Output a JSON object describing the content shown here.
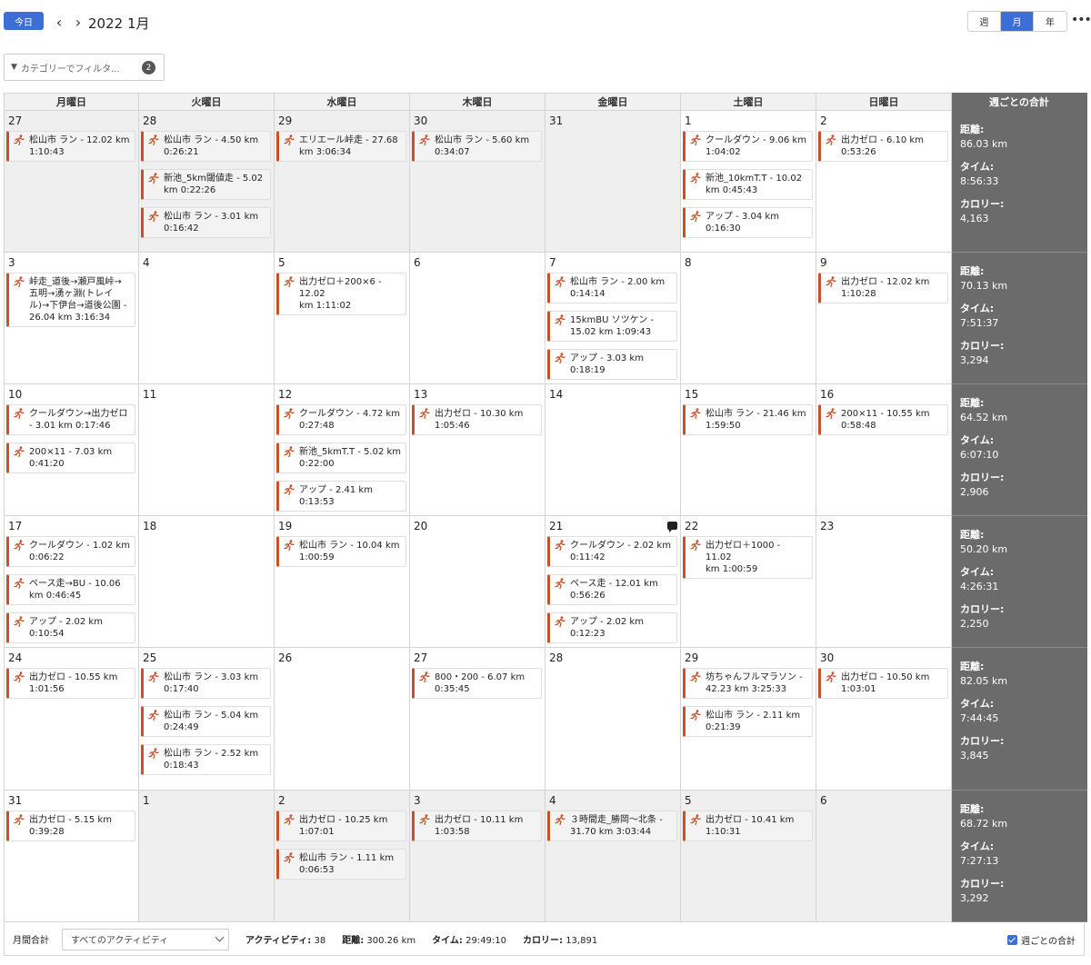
{
  "header": {
    "today_label": "今日",
    "prev_icon": "chevron-left-icon",
    "next_icon": "chevron-right-icon",
    "month_title": "2022 1月",
    "views": [
      {
        "label": "週",
        "active": false
      },
      {
        "label": "月",
        "active": true
      },
      {
        "label": "年",
        "active": false
      }
    ],
    "more_icon": "more-horizontal-icon",
    "accent_color": "#3b6fd6"
  },
  "filter": {
    "placeholder": "カテゴリーでフィルタ...",
    "count": "2"
  },
  "weekdays": [
    "月曜日",
    "火曜日",
    "水曜日",
    "木曜日",
    "金曜日",
    "土曜日",
    "日曜日"
  ],
  "totals_header": "週ごとの合計",
  "totals_labels": {
    "distance": "距離:",
    "time": "タイム:",
    "calories": "カロリー:"
  },
  "activity_color": "#c8512a",
  "activity_icon": "running-person-icon",
  "weeks": [
    {
      "days": [
        {
          "num": "27",
          "other": true,
          "acts": [
            [
              "松山市 ラン - 12.02 km",
              "1:10:43"
            ]
          ]
        },
        {
          "num": "28",
          "other": true,
          "acts": [
            [
              "松山市 ラン - 4.50 km",
              "0:26:21"
            ],
            [
              "新池_5km閾値走 - 5.02",
              "km 0:22:26"
            ],
            [
              "松山市 ラン - 3.01 km",
              "0:16:42"
            ]
          ]
        },
        {
          "num": "29",
          "other": true,
          "acts": [
            [
              "エリエール峠走 - 27.68",
              "km 3:06:34"
            ]
          ]
        },
        {
          "num": "30",
          "other": true,
          "acts": [
            [
              "松山市 ラン - 5.60 km",
              "0:34:07"
            ]
          ]
        },
        {
          "num": "31",
          "other": true,
          "acts": []
        },
        {
          "num": "1",
          "other": false,
          "acts": [
            [
              "クールダウン - 9.06 km",
              "1:04:02"
            ],
            [
              "新池_10kmT.T - 10.02",
              "km 0:45:43"
            ],
            [
              "アップ - 3.04 km 0:16:30"
            ]
          ]
        },
        {
          "num": "2",
          "other": false,
          "acts": [
            [
              "出力ゼロ - 6.10 km",
              "0:53:26"
            ]
          ]
        }
      ],
      "totals": {
        "distance": "86.03 km",
        "time": "8:56:33",
        "calories": "4,163"
      }
    },
    {
      "days": [
        {
          "num": "3",
          "other": false,
          "acts": [
            [
              "峠走_道後→瀬戸風峠→",
              "五明→湧ヶ淵(トレイ",
              "ル)→下伊台→道後公園 -",
              "26.04 km 3:16:34"
            ]
          ]
        },
        {
          "num": "4",
          "other": false,
          "acts": []
        },
        {
          "num": "5",
          "other": false,
          "acts": [
            [
              "出力ゼロ＋200×6 - 12.02",
              "km 1:11:02"
            ]
          ]
        },
        {
          "num": "6",
          "other": false,
          "acts": []
        },
        {
          "num": "7",
          "other": false,
          "acts": [
            [
              "松山市 ラン - 2.00 km",
              "0:14:14"
            ],
            [
              "15kmBU ソツケン -",
              "15.02 km 1:09:43"
            ],
            [
              "アップ - 3.03 km 0:18:19"
            ]
          ]
        },
        {
          "num": "8",
          "other": false,
          "acts": []
        },
        {
          "num": "9",
          "other": false,
          "acts": [
            [
              "出力ゼロ - 12.02 km",
              "1:10:28"
            ]
          ]
        }
      ],
      "totals": {
        "distance": "70.13 km",
        "time": "7:51:37",
        "calories": "3,294"
      }
    },
    {
      "days": [
        {
          "num": "10",
          "other": false,
          "acts": [
            [
              "クールダウン→出力ゼロ",
              "- 3.01 km 0:17:46"
            ],
            [
              "200×11 - 7.03 km",
              "0:41:20"
            ]
          ]
        },
        {
          "num": "11",
          "other": false,
          "acts": []
        },
        {
          "num": "12",
          "other": false,
          "acts": [
            [
              "クールダウン - 4.72 km",
              "0:27:48"
            ],
            [
              "新池_5kmT.T - 5.02 km",
              "0:22:00"
            ],
            [
              "アップ - 2.41 km 0:13:53"
            ]
          ]
        },
        {
          "num": "13",
          "other": false,
          "acts": [
            [
              "出力ゼロ - 10.30 km",
              "1:05:46"
            ]
          ]
        },
        {
          "num": "14",
          "other": false,
          "acts": []
        },
        {
          "num": "15",
          "other": false,
          "acts": [
            [
              "松山市 ラン - 21.46 km",
              "1:59:50"
            ]
          ]
        },
        {
          "num": "16",
          "other": false,
          "acts": [
            [
              "200×11 - 10.55 km",
              "0:58:48"
            ]
          ]
        }
      ],
      "totals": {
        "distance": "64.52 km",
        "time": "6:07:10",
        "calories": "2,906"
      }
    },
    {
      "days": [
        {
          "num": "17",
          "other": false,
          "acts": [
            [
              "クールダウン - 1.02 km",
              "0:06:22"
            ],
            [
              "ペース走→BU - 10.06",
              "km 0:46:45"
            ],
            [
              "アップ - 2.02 km 0:10:54"
            ]
          ]
        },
        {
          "num": "18",
          "other": false,
          "acts": []
        },
        {
          "num": "19",
          "other": false,
          "acts": [
            [
              "松山市 ラン - 10.04 km",
              "1:00:59"
            ]
          ]
        },
        {
          "num": "20",
          "other": false,
          "acts": []
        },
        {
          "num": "21",
          "other": false,
          "comment": true,
          "acts": [
            [
              "クールダウン - 2.02 km",
              "0:11:42"
            ],
            [
              "ペース走 - 12.01 km",
              "0:56:26"
            ],
            [
              "アップ - 2.02 km 0:12:23"
            ]
          ]
        },
        {
          "num": "22",
          "other": false,
          "acts": [
            [
              "出力ゼロ＋1000 - 11.02",
              "km 1:00:59"
            ]
          ]
        },
        {
          "num": "23",
          "other": false,
          "acts": []
        }
      ],
      "totals": {
        "distance": "50.20 km",
        "time": "4:26:31",
        "calories": "2,250"
      }
    },
    {
      "days": [
        {
          "num": "24",
          "other": false,
          "acts": [
            [
              "出力ゼロ - 10.55 km",
              "1:01:56"
            ]
          ]
        },
        {
          "num": "25",
          "other": false,
          "acts": [
            [
              "松山市 ラン - 3.03 km",
              "0:17:40"
            ],
            [
              "松山市 ラン - 5.04 km",
              "0:24:49"
            ],
            [
              "松山市 ラン - 2.52 km",
              "0:18:43"
            ]
          ]
        },
        {
          "num": "26",
          "other": false,
          "acts": []
        },
        {
          "num": "27",
          "other": false,
          "acts": [
            [
              "800・200 - 6.07 km",
              "0:35:45"
            ]
          ]
        },
        {
          "num": "28",
          "other": false,
          "acts": []
        },
        {
          "num": "29",
          "other": false,
          "acts": [
            [
              "坊ちゃんフルマラソン -",
              "42.23 km 3:25:33"
            ],
            [
              "松山市 ラン - 2.11 km",
              "0:21:39"
            ]
          ]
        },
        {
          "num": "30",
          "other": false,
          "acts": [
            [
              "出力ゼロ - 10.50 km",
              "1:03:01"
            ]
          ]
        }
      ],
      "totals": {
        "distance": "82.05 km",
        "time": "7:44:45",
        "calories": "3,845"
      }
    },
    {
      "days": [
        {
          "num": "31",
          "other": false,
          "acts": [
            [
              "出力ゼロ - 5.15 km",
              "0:39:28"
            ]
          ]
        },
        {
          "num": "1",
          "other": true,
          "acts": []
        },
        {
          "num": "2",
          "other": true,
          "acts": [
            [
              "出力ゼロ - 10.25 km",
              "1:07:01"
            ],
            [
              "松山市 ラン - 1.11 km",
              "0:06:53"
            ]
          ]
        },
        {
          "num": "3",
          "other": true,
          "acts": [
            [
              "出力ゼロ - 10.11 km",
              "1:03:58"
            ]
          ]
        },
        {
          "num": "4",
          "other": true,
          "acts": [
            [
              "３時間走_勝岡〜北条 -",
              "31.70 km 3:03:44"
            ]
          ]
        },
        {
          "num": "5",
          "other": true,
          "acts": [
            [
              "出力ゼロ - 10.41 km",
              "1:10:31"
            ]
          ]
        },
        {
          "num": "6",
          "other": true,
          "acts": []
        }
      ],
      "totals": {
        "distance": "68.72 km",
        "time": "7:27:13",
        "calories": "3,292"
      }
    }
  ],
  "footer": {
    "label": "月間合計",
    "select_value": "すべてのアクティビティ",
    "stats": [
      {
        "label": "アクティビティ:",
        "value": "38"
      },
      {
        "label": "距離:",
        "value": "300.26 km"
      },
      {
        "label": "タイム:",
        "value": "29:49:10"
      },
      {
        "label": "カロリー:",
        "value": "13,891"
      }
    ],
    "weekly_checkbox_label": "週ごとの合計"
  }
}
